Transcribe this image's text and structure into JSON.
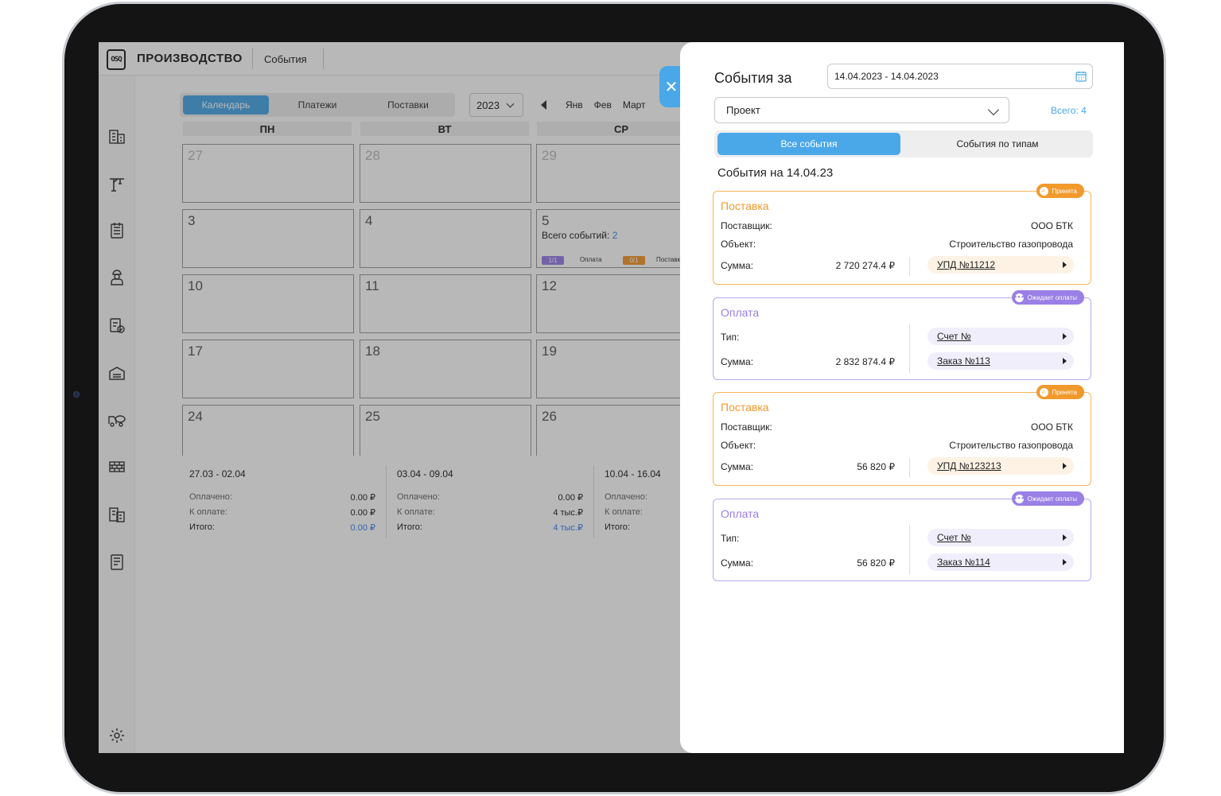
{
  "app": {
    "logo": "OSQ",
    "title": "ПРОИЗВОДСТВО",
    "breadcrumb": "События"
  },
  "sidebar": {
    "icons": [
      "buildings-icon",
      "crane-icon",
      "checklist-icon",
      "worker-icon",
      "clipboard-check-icon",
      "warehouse-icon",
      "mixer-truck-icon",
      "bricks-icon",
      "documents-icon",
      "report-icon",
      "settings-icon"
    ]
  },
  "calendar": {
    "tabs": [
      "Календарь",
      "Платежи",
      "Поставки"
    ],
    "active_tab": "Календарь",
    "year": "2023",
    "months": [
      "Янв",
      "Фев",
      "Март"
    ],
    "weekdays": [
      "ПН",
      "ВТ",
      "СР"
    ],
    "rows": [
      [
        "27",
        "28",
        "29"
      ],
      [
        "3",
        "4",
        "5"
      ],
      [
        "10",
        "11",
        "12"
      ],
      [
        "17",
        "18",
        "19"
      ],
      [
        "24",
        "25",
        "26"
      ]
    ],
    "cell_5": {
      "total_label": "Всего событий: ",
      "total_value": "2",
      "chip1": "1/1",
      "chip1_label": "Оплата",
      "chip2": "0/1",
      "chip2_label": "Поставка"
    },
    "weeks": [
      {
        "range": "27.03 - 02.04",
        "paid_label": "Оплачено:",
        "paid": "0.00 ₽",
        "due_label": "К оплате:",
        "due": "0.00 ₽",
        "total_label": "Итого:",
        "total": "0.00 ₽"
      },
      {
        "range": "03.04 - 09.04",
        "paid_label": "Оплачено:",
        "paid": "0.00 ₽",
        "due_label": "К оплате:",
        "due": "4 тыс.₽",
        "total_label": "Итого:",
        "total": "4 тыс.₽"
      },
      {
        "range": "10.04 - 16.04",
        "paid_label": "Оплачено:",
        "paid": "",
        "due_label": "К оплате:",
        "due": "",
        "total_label": "Итого:",
        "total": ""
      }
    ]
  },
  "panel": {
    "close_label": "✕",
    "title": "События за",
    "date_range": "14.04.2023 - 14.04.2023",
    "project_placeholder": "Проект",
    "total_count": "Всего: 4",
    "seg_all": "Все события",
    "seg_types": "События по типам",
    "events_date": "События на 14.04.23",
    "cards": [
      {
        "type": "Поставка",
        "badge": "Принята",
        "l1": "Поставщик:",
        "v1": "ООО БТК",
        "l2": "Объект:",
        "v2": "Строительство газопровода",
        "l3": "Сумма:",
        "sum": "2 720 274.4 ₽",
        "doc": "УПД №11212"
      },
      {
        "type": "Оплата",
        "badge": "Ожидает оплаты",
        "l1": "Тип:",
        "doc1": "Счет №",
        "l2": "Сумма:",
        "sum": "2 832 874.4 ₽",
        "doc2": "Заказ №113"
      },
      {
        "type": "Поставка",
        "badge": "Принята",
        "l1": "Поставщик:",
        "v1": "ООО БТК",
        "l2": "Объект:",
        "v2": "Строительство газопровода",
        "l3": "Сумма:",
        "sum": "56 820 ₽",
        "doc": "УПД №123213"
      },
      {
        "type": "Оплата",
        "badge": "Ожидает оплаты",
        "l1": "Тип:",
        "doc1": "Счет №",
        "l2": "Сумма:",
        "sum": "56 820 ₽",
        "doc2": "Заказ №114"
      }
    ]
  },
  "colors": {
    "accent": "#4aa8e8",
    "orange": "#f2992b",
    "purple": "#9a7fe6"
  }
}
